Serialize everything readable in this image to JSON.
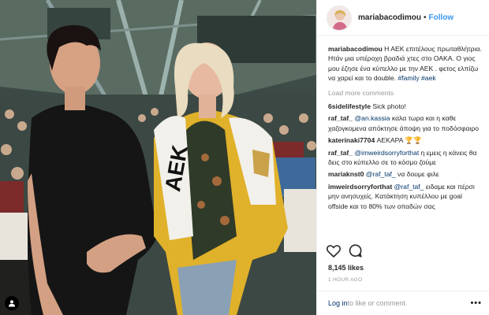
{
  "post": {
    "username": "mariabacodimou",
    "follow_label": "Follow",
    "separator": "•",
    "caption_username": "mariabacodimou",
    "caption_text": " Η ΑΕΚ επιτέλους πρωταθλήτρια. Ητάν μια υπέροχη βραδιά χτες στο ΟΑΚΑ. Ο γιος μου έζησε ένα κύπελλο με την ΑΕΚ . φετος ελπίζω να χαρεί και το double. ",
    "caption_tags": [
      "#family",
      "#aek"
    ],
    "load_more_label": "Load more comments",
    "likes": "8,145 likes",
    "time_ago": "1 HOUR AGO",
    "login_label": "Log in",
    "login_suffix": " to like or comment.",
    "more_label": "•••"
  },
  "comments": [
    {
      "author": "6sidelifestyle",
      "mention": "",
      "text": " Sick photo!"
    },
    {
      "author": "raf_taf_",
      "mention": " @an.kassia",
      "text": " καλα τωρα και η καθε χαζογκομενα απόκτησε άποψη για το ποδόσφαιρο"
    },
    {
      "author": "katerinaki7704",
      "mention": "",
      "text": " ΑΕΚΑΡΑ 🏆🏆"
    },
    {
      "author": "raf_taf_",
      "mention": " @imweirdsorryforthat",
      "text": " η εμεις η κάνεις θα δεις στο κύπελλο σε το κόσμο ζούμε"
    },
    {
      "author": "mariaknst0",
      "mention": " @raf_taf_",
      "text": " να δουμε φιλε"
    },
    {
      "author": "imweirdsorryforthat",
      "mention": " @raf_taf_",
      "text": " ειδαμε και πέρσι μην ανησυχείς. Κατάκτηση κυπέλλου με goal offside και το 80% των οπαδών σας"
    }
  ],
  "photo": {
    "scarf_text": "ΑΕΚ",
    "colors": {
      "crowd": "#3b4a45",
      "jacket": "#e0b12a",
      "shirt": "#151515",
      "scarf": "#f2f0ea"
    }
  }
}
